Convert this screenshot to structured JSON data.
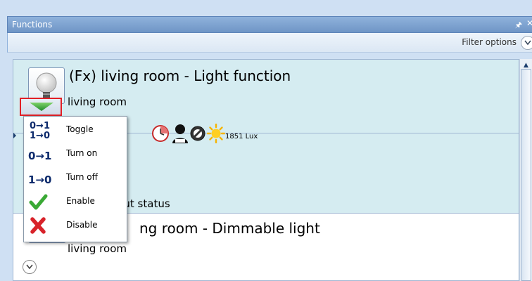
{
  "window": {
    "title": "Functions",
    "pin_icon": "pin-icon",
    "close_icon": "close-icon"
  },
  "filter": {
    "label": "Filter options",
    "icon": "chevron-down-icon"
  },
  "functions": [
    {
      "title": "(Fx) living room - Light function",
      "room": "living room",
      "lux_value": "1851 Lux",
      "status_icons": [
        "clock-icon",
        "person-icon",
        "disabled-icon",
        "sun-icon"
      ],
      "partial_text": "tput status"
    },
    {
      "title": "ng room - Dimmable light",
      "room": "living room"
    }
  ],
  "context_menu": {
    "items": [
      {
        "label": "Toggle",
        "icon": "toggle-icon"
      },
      {
        "label": "Turn on",
        "icon": "turn-on-icon"
      },
      {
        "label": "Turn off",
        "icon": "turn-off-icon"
      },
      {
        "label": "Enable",
        "icon": "check-icon"
      },
      {
        "label": "Disable",
        "icon": "cross-icon"
      }
    ],
    "codes": {
      "on": "0→1",
      "off": "1→0"
    }
  },
  "colors": {
    "highlight": "#d5ecf1",
    "title_bar": "#7a9fd0",
    "selection_box": "#e21f26"
  }
}
